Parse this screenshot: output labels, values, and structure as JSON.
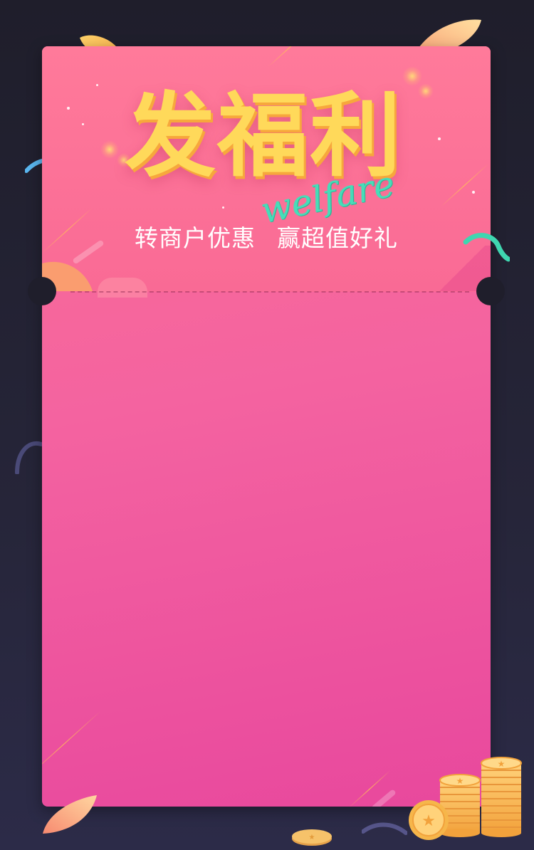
{
  "title": "发福利",
  "title_script": "welfare",
  "subtitle": {
    "part1": "转商户优惠",
    "part2": "赢超值好礼"
  },
  "colors": {
    "background": "#1f1e2b",
    "card": "#f463a0",
    "title": "#ffd95a",
    "script": "#48dcb8",
    "coin": "#f6b64a"
  },
  "decorations": [
    "leaf-icon",
    "ribbon-icon",
    "coin-stack-icon",
    "sparkle-icon"
  ]
}
